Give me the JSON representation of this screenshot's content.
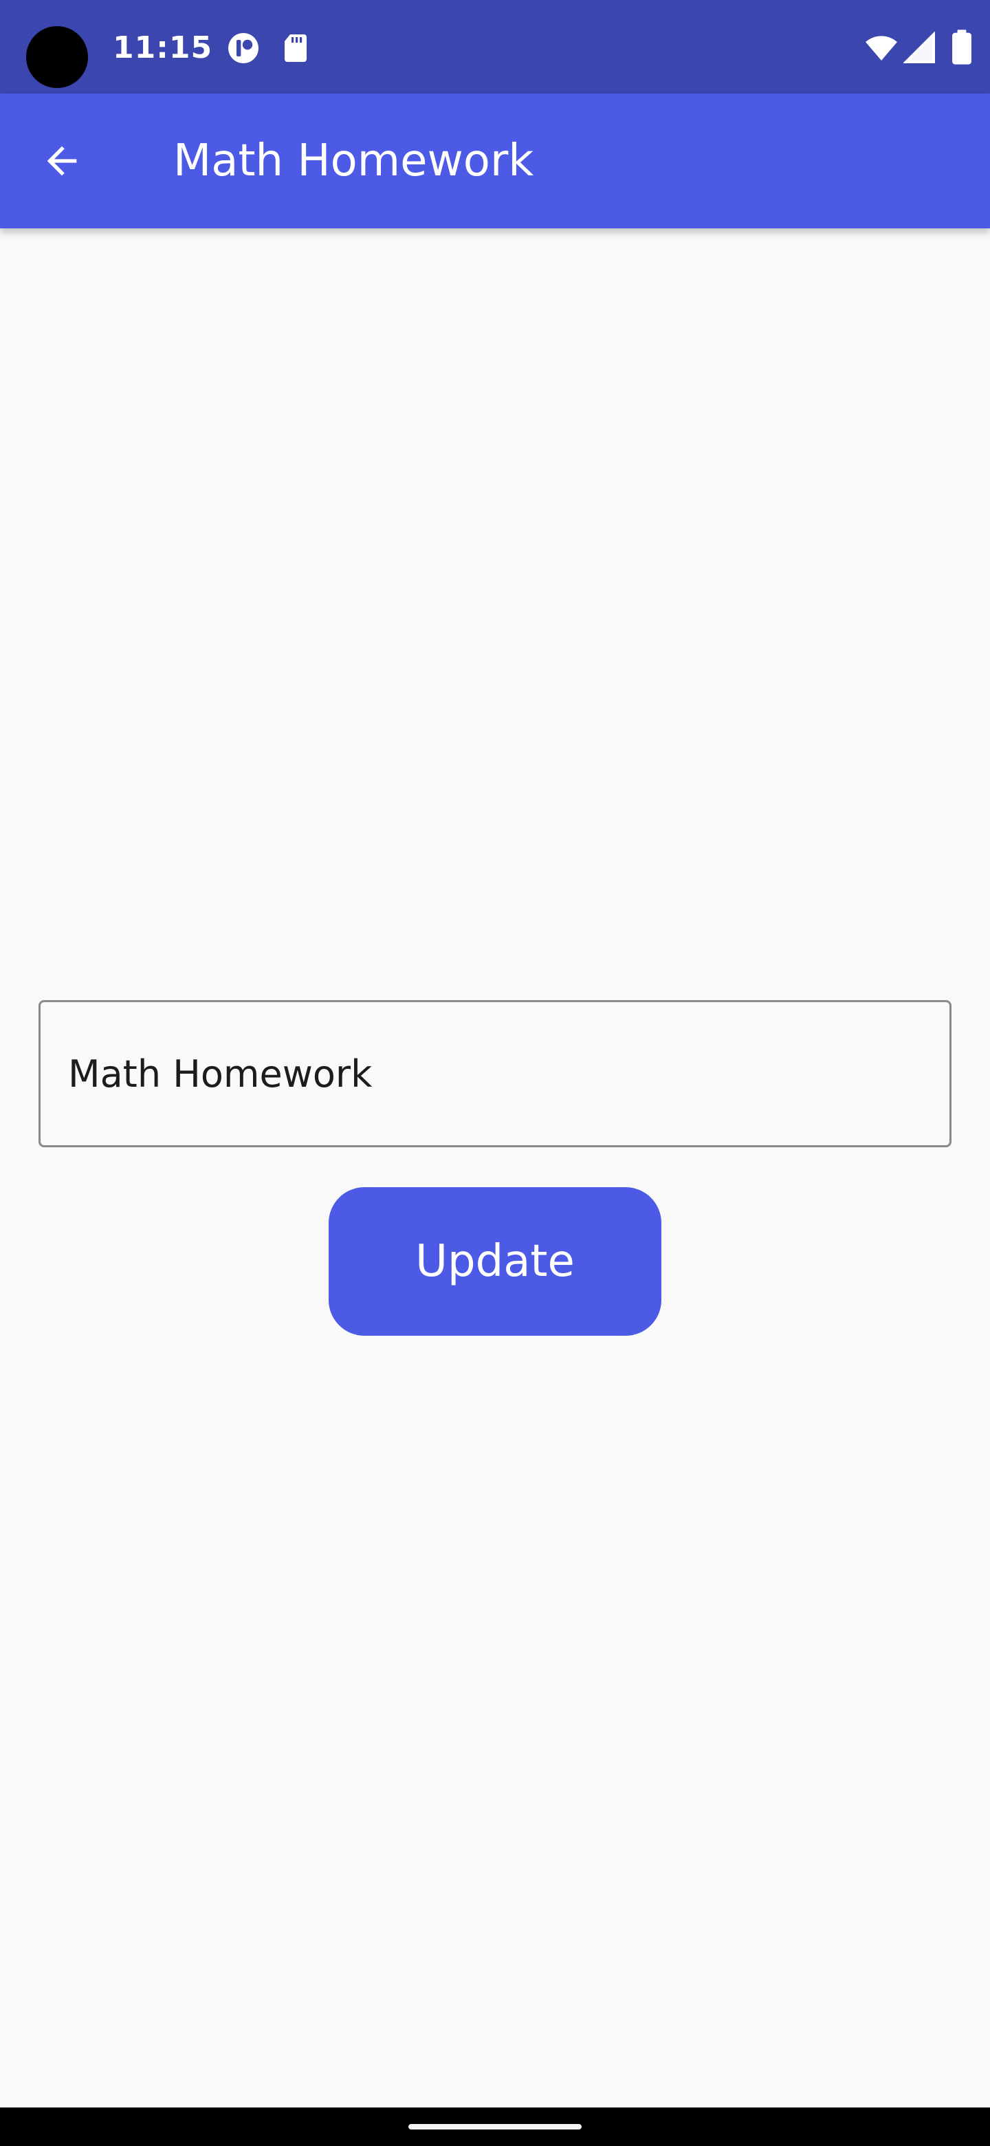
{
  "status_bar": {
    "time": "11:15",
    "icons": [
      "notification-icon",
      "sd-card-icon",
      "wifi-icon",
      "cell-signal-icon",
      "battery-icon"
    ],
    "background_color": "#3b46af"
  },
  "app_bar": {
    "title": "Math Homework",
    "back_icon": "arrow-back-icon",
    "background_color": "#4d5ae5"
  },
  "form": {
    "name_field_value": "Math Homework",
    "update_label": "Update",
    "accent_color": "#4d5ae5"
  }
}
